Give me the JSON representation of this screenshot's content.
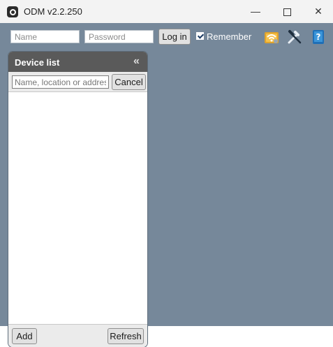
{
  "window": {
    "title": "ODM v2.2.250",
    "minimize_glyph": "—",
    "close_glyph": "✕"
  },
  "toolbar": {
    "name_placeholder": "Name",
    "password_placeholder": "Password",
    "login_label": "Log in",
    "remember_label": "Remember",
    "remember_checked": true,
    "icons": [
      "wifi-settings-icon",
      "tools-icon",
      "help-book-icon"
    ]
  },
  "device_panel": {
    "title": "Device list",
    "collapse_glyph": "«",
    "search_placeholder": "Name, location or address",
    "cancel_label": "Cancel",
    "add_label": "Add",
    "refresh_label": "Refresh",
    "devices": []
  },
  "colors": {
    "background": "#76889a",
    "panel_header": "#5a5a5a"
  }
}
